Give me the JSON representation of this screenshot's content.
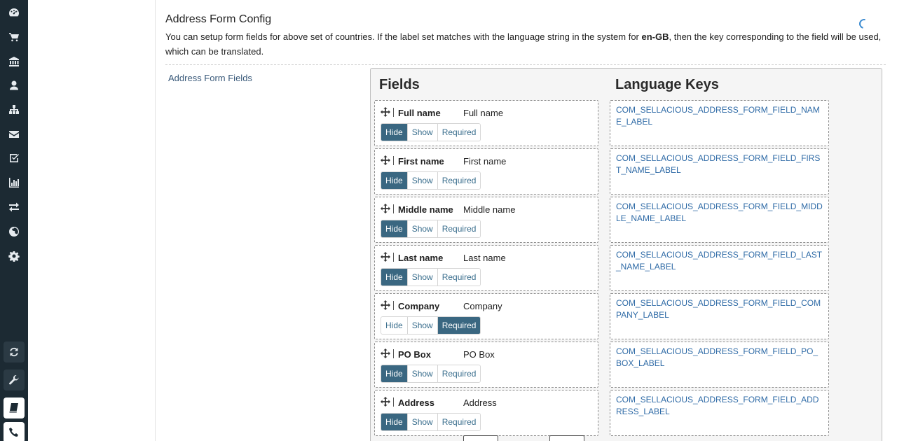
{
  "sidebar": {
    "icons": [
      {
        "name": "dashboard-icon"
      },
      {
        "name": "cart-icon"
      },
      {
        "name": "bank-icon"
      },
      {
        "name": "user-icon"
      },
      {
        "name": "sitemap-icon"
      },
      {
        "name": "envelope-icon"
      },
      {
        "name": "checkbox-icon"
      },
      {
        "name": "bar-chart-icon"
      },
      {
        "name": "exchange-icon"
      },
      {
        "name": "globe-icon"
      },
      {
        "name": "gear-icon"
      }
    ],
    "bottom_buttons": [
      {
        "name": "refresh-icon"
      },
      {
        "name": "wrench-icon"
      },
      {
        "name": "book-icon"
      },
      {
        "name": "phone-icon"
      }
    ]
  },
  "header": {
    "title": "Address Form Config",
    "description_prefix": "You can setup form fields for above set of countries. If the label set matches with the language string in the system for ",
    "language_code": "en-GB",
    "description_suffix": ", then the key corresponding to the field will be used, which can be translated."
  },
  "form": {
    "field_label": "Address Form Fields",
    "fields_heading": "Fields",
    "keys_heading": "Language Keys",
    "options": {
      "hide": "Hide",
      "show": "Show",
      "required": "Required"
    },
    "fields": [
      {
        "name": "Full name",
        "label": "Full name",
        "state": "hide",
        "key": "COM_SELLACIOUS_ADDRESS_FORM_FIELD_NAME_LABEL"
      },
      {
        "name": "First name",
        "label": "First name",
        "state": "hide",
        "key": "COM_SELLACIOUS_ADDRESS_FORM_FIELD_FIRST_NAME_LABEL"
      },
      {
        "name": "Middle name",
        "label": "Middle name",
        "state": "hide",
        "key": "COM_SELLACIOUS_ADDRESS_FORM_FIELD_MIDDLE_NAME_LABEL"
      },
      {
        "name": "Last name",
        "label": "Last name",
        "state": "hide",
        "key": "COM_SELLACIOUS_ADDRESS_FORM_FIELD_LAST_NAME_LABEL"
      },
      {
        "name": "Company",
        "label": "Company",
        "state": "required",
        "key": "COM_SELLACIOUS_ADDRESS_FORM_FIELD_COMPANY_LABEL"
      },
      {
        "name": "PO Box",
        "label": "PO Box",
        "state": "hide",
        "key": "COM_SELLACIOUS_ADDRESS_FORM_FIELD_PO_BOX_LABEL"
      },
      {
        "name": "Address",
        "label": "Address",
        "state": "hide",
        "key": "COM_SELLACIOUS_ADDRESS_FORM_FIELD_ADDRESS_LABEL"
      }
    ]
  },
  "colors": {
    "rail": "#1c2a33",
    "active_button": "#3a6781",
    "link": "#2e6aa6"
  }
}
